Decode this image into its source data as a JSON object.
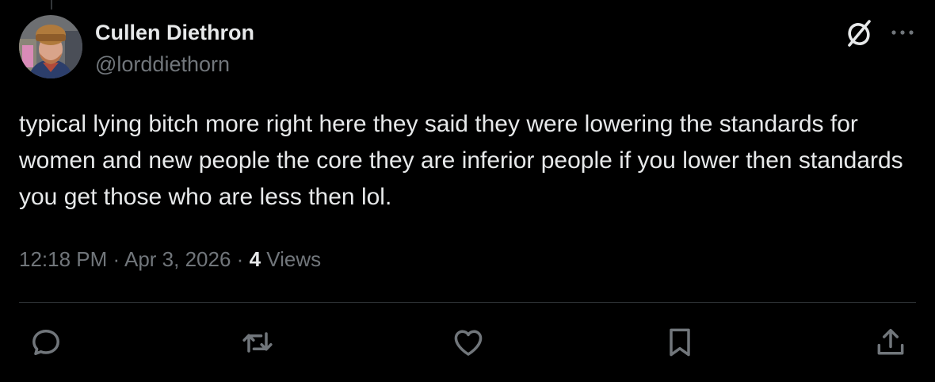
{
  "author": {
    "display_name": "Cullen Diethron",
    "handle": "@lorddiethorn",
    "avatar_icon": "user-avatar-photo"
  },
  "tweet": {
    "text": "typical lying bitch more right here they said they were lowering the standards for women and new people the core they are inferior people if you lower then standards you get those who are less then lol."
  },
  "meta": {
    "time": "12:18 PM",
    "separator": "·",
    "date": "Apr 3, 2026",
    "views_count": "4",
    "views_label": "Views"
  },
  "header_icons": [
    "grok-icon",
    "more-options-icon"
  ],
  "actions": [
    {
      "name": "reply",
      "icon": "reply-icon"
    },
    {
      "name": "retweet",
      "icon": "retweet-icon"
    },
    {
      "name": "like",
      "icon": "heart-icon"
    },
    {
      "name": "bookmark",
      "icon": "bookmark-icon"
    },
    {
      "name": "share",
      "icon": "share-icon"
    }
  ],
  "colors": {
    "background": "#000000",
    "primary_text": "#e7e9ea",
    "secondary_text": "#71767b",
    "divider": "#2f3336"
  }
}
